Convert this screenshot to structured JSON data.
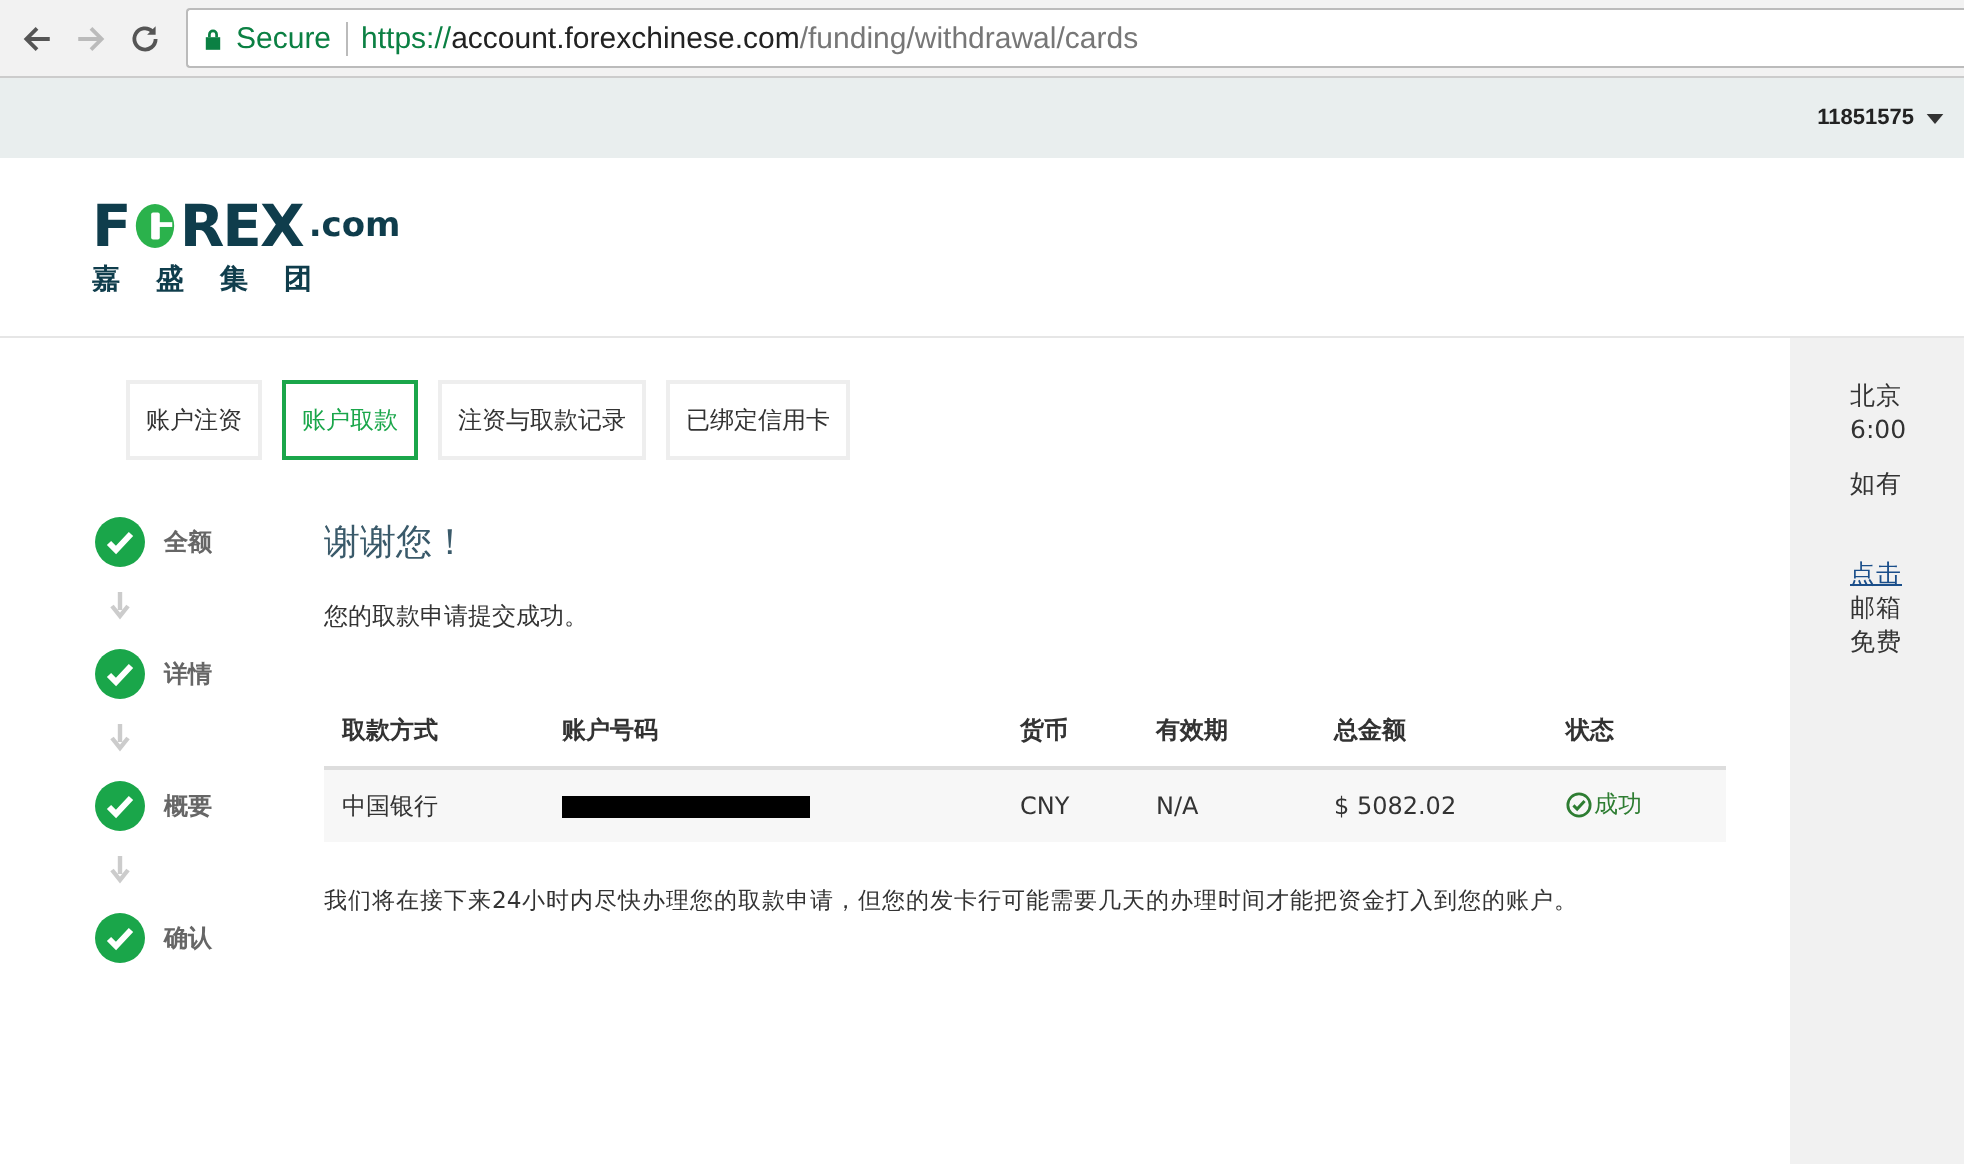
{
  "browser": {
    "secure_label": "Secure",
    "url_scheme": "https://",
    "url_host": "account.forexchinese.com",
    "url_path": "/funding/withdrawal/cards"
  },
  "top_bar": {
    "account": "11851575"
  },
  "logo": {
    "wordmark_start": "F",
    "wordmark_end": "REX",
    "suffix": ".com",
    "tagline": [
      "嘉",
      "盛",
      "集",
      "团"
    ]
  },
  "tabs": [
    {
      "label": "账户注资",
      "selected": false
    },
    {
      "label": "账户取款",
      "selected": true
    },
    {
      "label": "注资与取款记录",
      "selected": false
    },
    {
      "label": "已绑定信用卡",
      "selected": false
    }
  ],
  "steps": [
    {
      "label": "全额",
      "done": true
    },
    {
      "label": "详情",
      "done": true
    },
    {
      "label": "概要",
      "done": true
    },
    {
      "label": "确认",
      "done": true
    }
  ],
  "heading": "谢谢您！",
  "message": "您的取款申请提交成功。",
  "table": {
    "columns": [
      "取款方式",
      "账户号码",
      "货币",
      "有效期",
      "总金额",
      "状态"
    ],
    "rows": [
      {
        "method": "中国银行",
        "account_redacted": true,
        "currency": "CNY",
        "expiry": "N/A",
        "amount": "$ 5082.02",
        "status": "成功",
        "success": true
      }
    ]
  },
  "note": "我们将在接下来24小时内尽快办理您的取款申请，但您的发卡行可能需要几天的办理时间才能把资金打入到您的账户。",
  "side_panel": {
    "lines": [
      {
        "text": "北京",
        "kind": "text"
      },
      {
        "text": "6:00",
        "kind": "text"
      },
      {
        "text": "如有",
        "kind": "text"
      },
      {
        "text": "点击",
        "kind": "link"
      },
      {
        "text": "邮箱",
        "kind": "text"
      },
      {
        "text": "免费",
        "kind": "text"
      }
    ]
  }
}
